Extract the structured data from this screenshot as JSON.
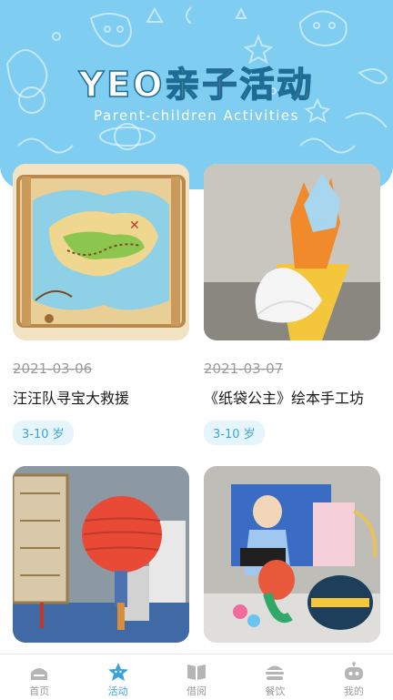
{
  "banner": {
    "title_latin": "YEO",
    "title_cn": [
      "亲",
      "子",
      "活",
      "动"
    ],
    "subtitle": "Parent-children Activities"
  },
  "activities": [
    {
      "date": "2021-03-06",
      "title": "汪汪队寻宝大救援",
      "age": "3-10 岁",
      "image": "treasure-map-image"
    },
    {
      "date": "2021-03-07",
      "title": "《纸袋公主》绘本手工坊",
      "age": "3-10 岁",
      "image": "paper-crown-image"
    },
    {
      "image": "paper-lantern-image"
    },
    {
      "image": "toys-display-image"
    }
  ],
  "tabs": [
    {
      "label": "首页",
      "icon": "home-icon",
      "active": false
    },
    {
      "label": "活动",
      "icon": "star-icon",
      "active": true
    },
    {
      "label": "借阅",
      "icon": "book-icon",
      "active": false
    },
    {
      "label": "餐饮",
      "icon": "burger-icon",
      "active": false
    },
    {
      "label": "我的",
      "icon": "robot-icon",
      "active": false
    }
  ],
  "colors": {
    "banner_bg": "#7fcdf0",
    "accent": "#3aa3dc",
    "tab_inactive": "#9a9a9a"
  }
}
